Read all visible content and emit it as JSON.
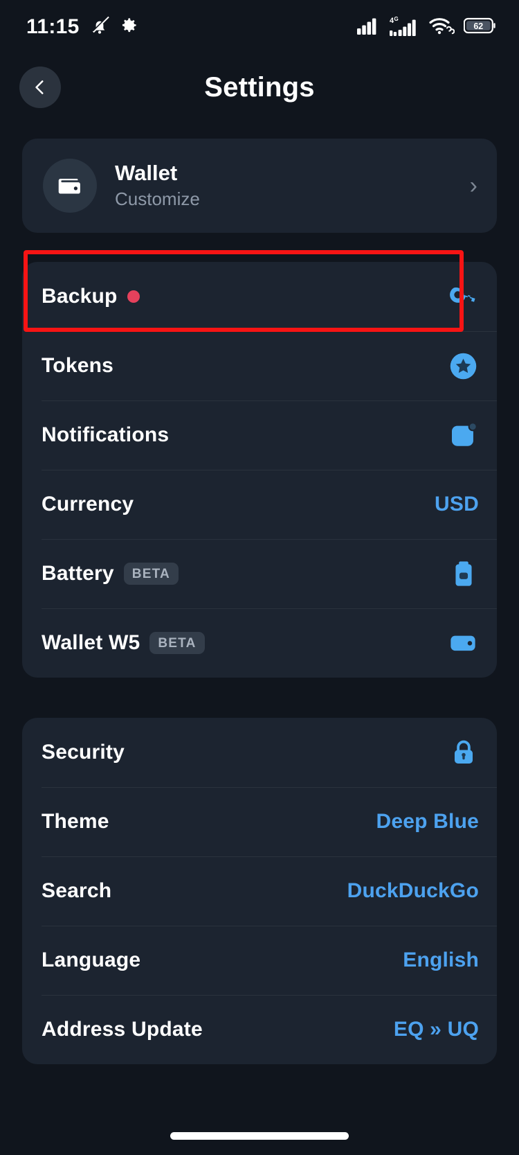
{
  "status_bar": {
    "time": "11:15",
    "icons": [
      "mute-bell-icon",
      "gear-icon"
    ],
    "right_icons": [
      "signal-bars-icon",
      "4g-signal-bars-icon",
      "wifi-icon",
      "battery-icon"
    ],
    "network_label": "4G",
    "battery_level": "62"
  },
  "header": {
    "title": "Settings",
    "back_icon": "chevron-left-icon"
  },
  "wallet_card": {
    "icon": "wallet-icon",
    "title": "Wallet",
    "subtitle": "Customize",
    "chevron": "›"
  },
  "group_one": {
    "rows": [
      {
        "label": "Backup",
        "badge": "dot",
        "icon": "key-icon",
        "value": ""
      },
      {
        "label": "Tokens",
        "badge": "",
        "icon": "star-circle-icon",
        "value": ""
      },
      {
        "label": "Notifications",
        "badge": "",
        "icon": "notification-bell-icon",
        "value": ""
      },
      {
        "label": "Currency",
        "badge": "",
        "icon": "",
        "value": "USD"
      },
      {
        "label": "Battery",
        "badge": "BETA",
        "icon": "battery-icon",
        "value": ""
      },
      {
        "label": "Wallet W5",
        "badge": "BETA",
        "icon": "wallet-w5-icon",
        "value": ""
      }
    ]
  },
  "group_two": {
    "rows": [
      {
        "label": "Security",
        "icon": "lock-icon",
        "value": ""
      },
      {
        "label": "Theme",
        "icon": "",
        "value": "Deep Blue"
      },
      {
        "label": "Search",
        "icon": "",
        "value": "DuckDuckGo"
      },
      {
        "label": "Language",
        "icon": "",
        "value": "English"
      },
      {
        "label": "Address Update",
        "icon": "",
        "value": "EQ » UQ"
      }
    ]
  },
  "colors": {
    "background": "#10151d",
    "card": "#1c2430",
    "accent_blue": "#4da2ef",
    "icon_blue": "#4ba9f0",
    "badge_red": "#e5415c",
    "highlight_red": "#f71414",
    "text_primary": "#ffffff",
    "text_secondary": "#8e99a8"
  }
}
